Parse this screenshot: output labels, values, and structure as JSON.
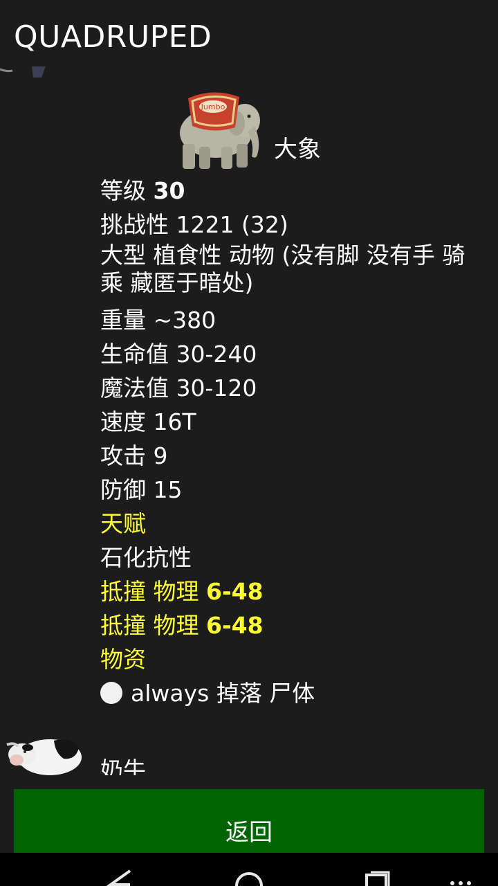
{
  "app": {
    "title": "QUADRUPED"
  },
  "entry": {
    "name": "大象",
    "level_label": "等级",
    "level_value": "30",
    "challenge": "挑战性 1221 (32)",
    "traits": "大型 植食性 动物 (没有脚 没有手 骑乘 藏匿于暗处)",
    "weight": "重量 ~380",
    "hp": "生命值 30-240",
    "mp": "魔法值 30-120",
    "speed": "速度 16T",
    "attack": "攻击 9",
    "defense": "防御 15",
    "talent_heading": "天赋",
    "talent_1": "石化抗性",
    "attack_1_label": "抵撞 物理",
    "attack_1_value": "6-48",
    "attack_2_label": "抵撞 物理",
    "attack_2_value": "6-48",
    "loot_heading": "物资",
    "loot_1": "always 掉落 尸体"
  },
  "next_entry": {
    "name": "奶牛"
  },
  "footer": {
    "back_label": "返回"
  },
  "colors": {
    "background": "#1c1c1c",
    "highlight": "#ffff33",
    "button": "#006400"
  },
  "icons": {
    "nav_back": "triangle-back-icon",
    "nav_home": "circle-home-icon",
    "nav_recents": "square-recents-icon",
    "nav_menu": "dots-menu-icon"
  }
}
